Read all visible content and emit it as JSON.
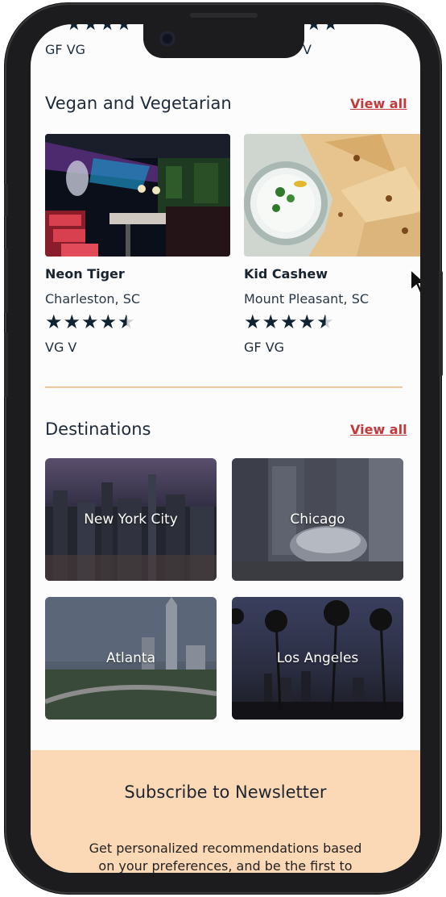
{
  "top_partial": {
    "left_tags": "GF   VG",
    "right_tags": "V"
  },
  "vegan": {
    "title": "Vegan and Vegetarian",
    "view_all": "View all",
    "cards": [
      {
        "name": "Neon Tiger",
        "location": "Charleston, SC",
        "rating": 4.5,
        "tags": "VG   V"
      },
      {
        "name": "Kid Cashew",
        "location": "Mount Pleasant, SC",
        "rating": 4.5,
        "tags": "GF   VG"
      }
    ]
  },
  "destinations": {
    "title": "Destinations",
    "view_all": "View all",
    "items": [
      {
        "label": "New York City"
      },
      {
        "label": "Chicago"
      },
      {
        "label": "Atlanta"
      },
      {
        "label": "Los Angeles"
      }
    ]
  },
  "newsletter": {
    "title": "Subscribe to Newsletter",
    "line1": "Get personalized recommendations based",
    "line2": "on your preferences, and be the first to"
  },
  "colors": {
    "accent": "#c0393b",
    "divider": "#efc99b",
    "newsletter_bg": "#fcd9b6",
    "star": "#0f2333"
  },
  "icons": [
    "star-icon",
    "half-star-icon",
    "cursor-icon"
  ]
}
